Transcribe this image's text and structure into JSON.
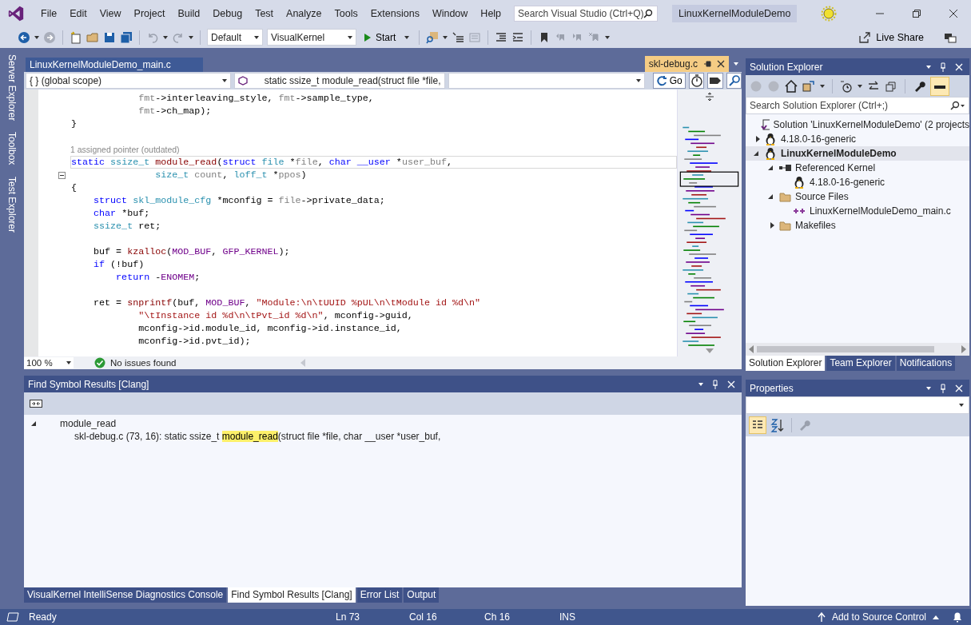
{
  "menu": [
    "File",
    "Edit",
    "View",
    "Project",
    "Build",
    "Debug",
    "Test",
    "Analyze",
    "Tools",
    "Extensions",
    "Window",
    "Help"
  ],
  "search": {
    "placeholder": "Search Visual Studio (Ctrl+Q)"
  },
  "solution_name": "LinuxKernelModuleDemo",
  "toolbar": {
    "configuration": "Default",
    "platform": "VisualKernel",
    "start": "Start",
    "live_share": "Live Share"
  },
  "side_tabs": [
    "Server Explorer",
    "Toolbox",
    "Test Explorer"
  ],
  "editor": {
    "tabs": [
      {
        "label": "LinuxKernelModuleDemo_main.c",
        "selected": false
      },
      {
        "label": "skl-debug.c",
        "selected": true
      }
    ],
    "scope": "{ } (global scope)",
    "member": "static ssize_t module_read(struct file *file,",
    "go": "Go",
    "lines": [
      {
        "kind": "code",
        "current": false,
        "fold": false,
        "tokens": [
          {
            "param": "            fmt"
          },
          {
            "plain": "->interleaving_style, "
          },
          {
            "param": "fmt"
          },
          {
            "plain": "->sample_type,"
          }
        ]
      },
      {
        "kind": "code",
        "current": false,
        "fold": false,
        "tokens": [
          {
            "param": "            fmt"
          },
          {
            "plain": "->ch_map);"
          }
        ]
      },
      {
        "kind": "code",
        "current": false,
        "fold": false,
        "tokens": [
          {
            "plain": "}"
          }
        ]
      },
      {
        "kind": "blank"
      },
      {
        "kind": "lens",
        "text": "1 assigned pointer (outdated)"
      },
      {
        "kind": "code",
        "current": true,
        "fold": false,
        "tokens": [
          {
            "keyword": "static "
          },
          {
            "type": "ssize_t "
          },
          {
            "function": "module_read"
          },
          {
            "plain": "("
          },
          {
            "keyword": "struct "
          },
          {
            "type": "file "
          },
          {
            "plain": "*"
          },
          {
            "param": "file"
          },
          {
            "plain": ", "
          },
          {
            "keyword": "char __user "
          },
          {
            "plain": "*"
          },
          {
            "param": "user_buf"
          },
          {
            "plain": ","
          }
        ]
      },
      {
        "kind": "code",
        "current": false,
        "fold": true,
        "tokens": [
          {
            "type": "               size_t "
          },
          {
            "param": "count"
          },
          {
            "plain": ", "
          },
          {
            "type": "loff_t "
          },
          {
            "plain": "*"
          },
          {
            "param": "ppos"
          },
          {
            "plain": ")"
          }
        ]
      },
      {
        "kind": "code",
        "current": false,
        "fold": false,
        "tokens": [
          {
            "plain": "{"
          }
        ]
      },
      {
        "kind": "code",
        "current": false,
        "fold": false,
        "tokens": [
          {
            "keyword": "    struct "
          },
          {
            "type": "skl_module_cfg "
          },
          {
            "plain": "*mconfig = "
          },
          {
            "param": "file"
          },
          {
            "plain": "->private_data;"
          }
        ]
      },
      {
        "kind": "code",
        "current": false,
        "fold": false,
        "tokens": [
          {
            "keyword": "    char "
          },
          {
            "plain": "*buf;"
          }
        ]
      },
      {
        "kind": "code",
        "current": false,
        "fold": false,
        "tokens": [
          {
            "type": "    ssize_t "
          },
          {
            "plain": "ret;"
          }
        ]
      },
      {
        "kind": "blank"
      },
      {
        "kind": "code",
        "current": false,
        "fold": false,
        "tokens": [
          {
            "plain": "    buf = "
          },
          {
            "function": "kzalloc"
          },
          {
            "plain": "("
          },
          {
            "macro": "MOD_BUF"
          },
          {
            "plain": ", "
          },
          {
            "macro": "GFP_KERNEL"
          },
          {
            "plain": ");"
          }
        ]
      },
      {
        "kind": "code",
        "current": false,
        "fold": false,
        "tokens": [
          {
            "keyword": "    if "
          },
          {
            "plain": "(!buf)"
          }
        ]
      },
      {
        "kind": "code",
        "current": false,
        "fold": false,
        "tokens": [
          {
            "keyword": "        return "
          },
          {
            "plain": "-"
          },
          {
            "macro": "ENOMEM"
          },
          {
            "plain": ";"
          }
        ]
      },
      {
        "kind": "blank"
      },
      {
        "kind": "code",
        "current": false,
        "fold": false,
        "tokens": [
          {
            "plain": "    ret = "
          },
          {
            "function": "snprintf"
          },
          {
            "plain": "(buf, "
          },
          {
            "macro": "MOD_BUF"
          },
          {
            "plain": ", "
          },
          {
            "string": "\"Module:\\n\\tUUID %pUL\\n\\tModule id %d\\n\""
          }
        ]
      },
      {
        "kind": "code",
        "current": false,
        "fold": false,
        "tokens": [
          {
            "string": "            \"\\tInstance id %d\\n\\tPvt_id %d\\n\""
          },
          {
            "plain": ", mconfig->guid,"
          }
        ]
      },
      {
        "kind": "code",
        "current": false,
        "fold": false,
        "tokens": [
          {
            "plain": "            mconfig->id.module_id, mconfig->id.instance_id,"
          }
        ]
      },
      {
        "kind": "code",
        "current": false,
        "fold": false,
        "tokens": [
          {
            "plain": "            mconfig->id.pvt_id);"
          }
        ]
      }
    ],
    "zoom": "100 %",
    "issues": "No issues found"
  },
  "find_results": {
    "title": "Find Symbol Results [Clang]",
    "symbol": "module_read",
    "expanded": true,
    "result": {
      "before": "skl-debug.c (73, 16): static ssize_t ",
      "match": "module_read",
      "after": "(struct file *file, char __user *user_buf,"
    }
  },
  "bottom_tabs": [
    {
      "label": "VisualKernel IntelliSense Diagnostics Console",
      "selected": false
    },
    {
      "label": "Find Symbol Results [Clang]",
      "selected": true
    },
    {
      "label": "Error List",
      "selected": false
    },
    {
      "label": "Output",
      "selected": false
    }
  ],
  "solution_explorer": {
    "title": "Solution Explorer",
    "search": {
      "placeholder": "Search Solution Explorer (Ctrl+;)"
    },
    "tree": [
      {
        "label": "Solution 'LinuxKernelModuleDemo' (2 projects",
        "kind": "solution",
        "selected": false
      },
      {
        "label": "4.18.0-16-generic",
        "kind": "penguin",
        "selected": false,
        "expanded": false
      },
      {
        "label": "LinuxKernelModuleDemo",
        "kind": "penguin",
        "selected": true,
        "expanded": true,
        "children": [
          {
            "label": "Referenced Kernel",
            "kind": "reference",
            "selected": false,
            "expanded": true,
            "children": [
              {
                "label": "4.18.0-16-generic",
                "kind": "penguin",
                "selected": false
              }
            ]
          },
          {
            "label": "Source Files",
            "kind": "folder",
            "selected": false,
            "expanded": true,
            "children": [
              {
                "label": "LinuxKernelModuleDemo_main.c",
                "kind": "cfile",
                "selected": false
              }
            ]
          },
          {
            "label": "Makefiles",
            "kind": "folder",
            "selected": false,
            "expanded": false
          }
        ]
      }
    ],
    "tabs": [
      {
        "label": "Solution Explorer",
        "selected": true
      },
      {
        "label": "Team Explorer",
        "selected": false
      },
      {
        "label": "Notifications",
        "selected": false
      }
    ]
  },
  "properties": {
    "title": "Properties"
  },
  "status_bar": {
    "state": "Ready",
    "line": "Ln 73",
    "column": "Col 16",
    "char": "Ch 16",
    "mode": "INS",
    "source_control": "Add to Source Control"
  }
}
